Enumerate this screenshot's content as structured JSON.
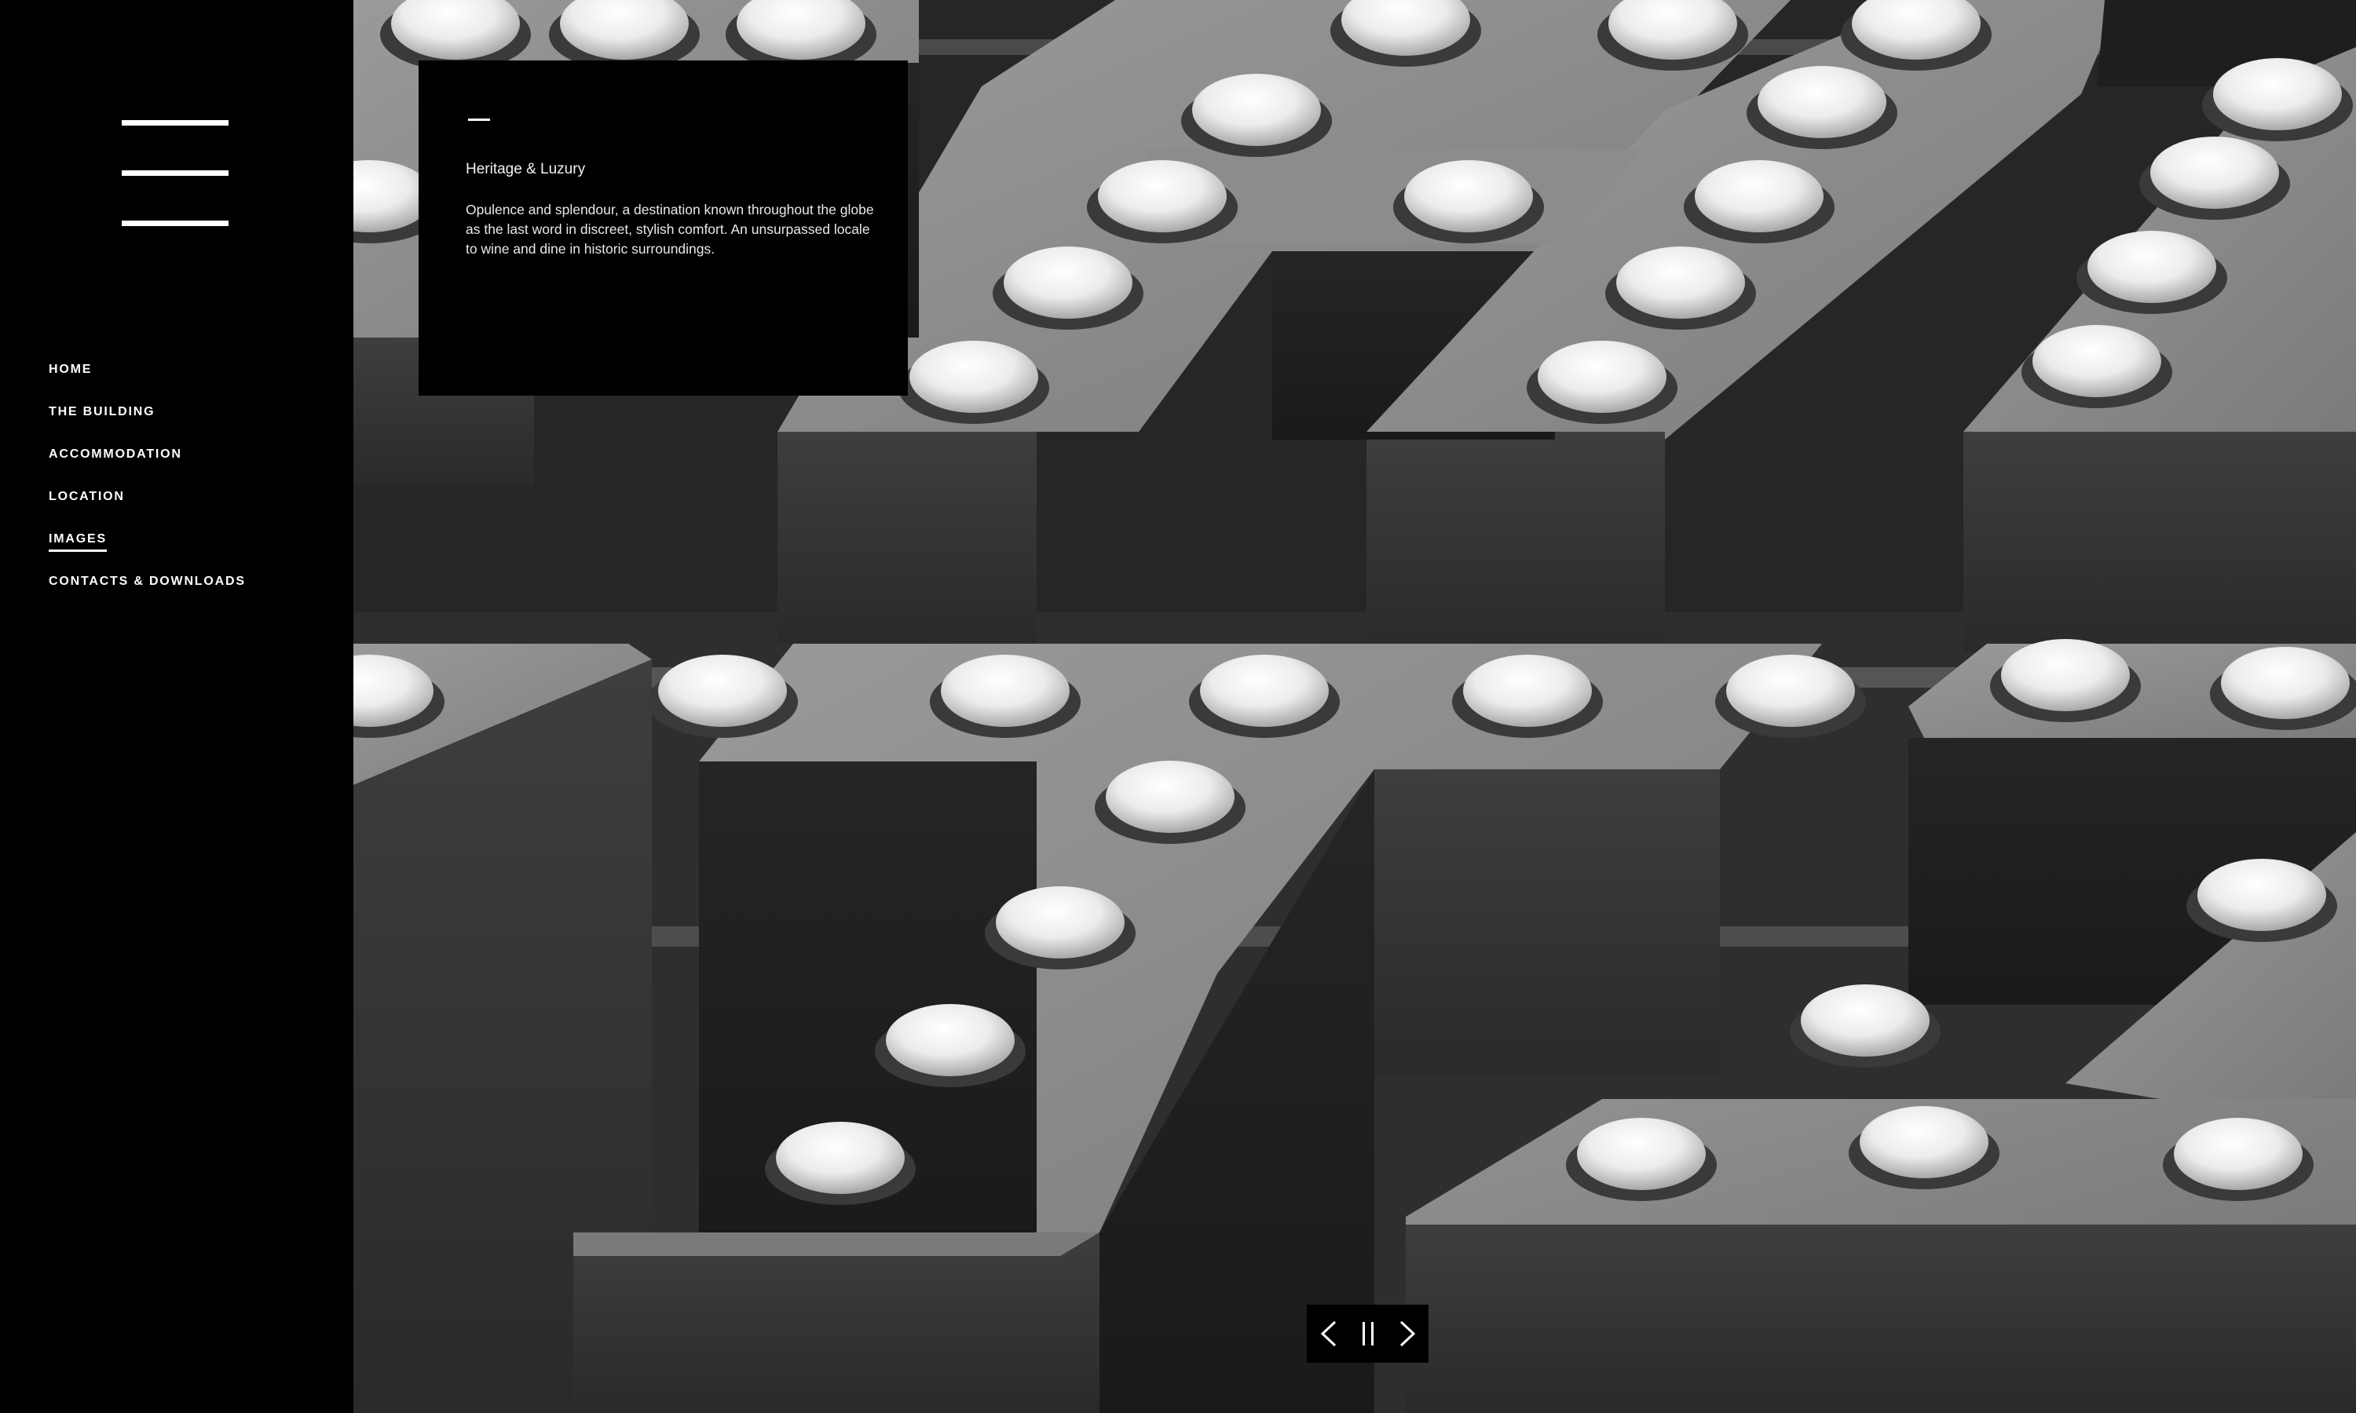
{
  "sidebar": {
    "menu_icon": "hamburger-menu-icon",
    "nav": [
      {
        "label": "HOME",
        "active": false
      },
      {
        "label": "THE BUILDING",
        "active": false
      },
      {
        "label": "ACCOMMODATION",
        "active": false
      },
      {
        "label": "LOCATION",
        "active": false
      },
      {
        "label": "IMAGES",
        "active": true
      },
      {
        "label": "CONTACTS & DOWNLOADS",
        "active": false
      }
    ]
  },
  "card": {
    "title": "Heritage & Luzury",
    "description": "Opulence and splendour, a destination known throughout the globe as the last word in discreet, stylish comfort. An unsurpassed locale to wine and dine in historic surroundings."
  },
  "slideshow": {
    "prev_icon": "chevron-left-icon",
    "pause_icon": "pause-icon",
    "next_icon": "chevron-right-icon"
  },
  "colors": {
    "background": "#000000",
    "text": "#ffffff",
    "photo_tone": "grayscale"
  }
}
